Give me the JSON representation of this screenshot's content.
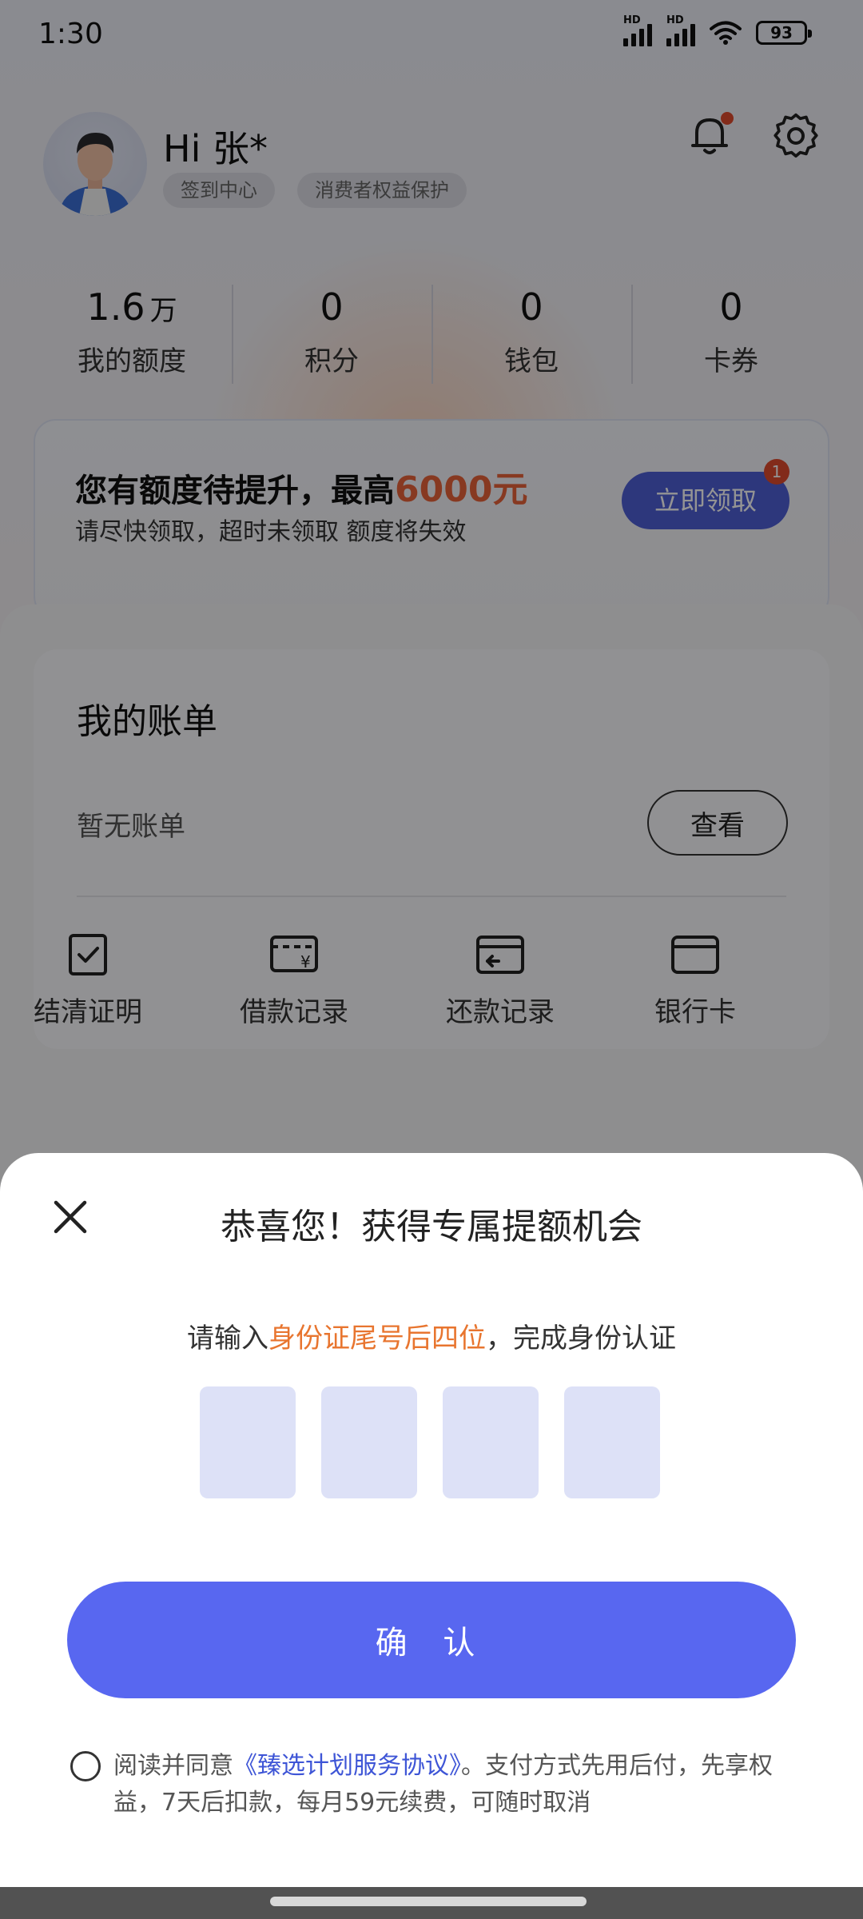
{
  "status_bar": {
    "time": "1:30",
    "signal1_label": "HD",
    "signal2_label": "HD",
    "battery": "93"
  },
  "profile": {
    "greeting": "Hi 张*",
    "checkin_label": "签到中心",
    "consumer_label": "消费者权益保护"
  },
  "stats": [
    {
      "value": "1.6",
      "unit": "万",
      "label": "我的额度"
    },
    {
      "value": "0",
      "unit": "",
      "label": "积分"
    },
    {
      "value": "0",
      "unit": "",
      "label": "钱包"
    },
    {
      "value": "0",
      "unit": "",
      "label": "卡券"
    }
  ],
  "promo": {
    "title_prefix": "您有额度待提升，最高",
    "amount": "6000元",
    "subtitle": "请尽快领取，超时未领取 额度将失效",
    "button": "立即领取",
    "badge": "1"
  },
  "bill": {
    "title": "我的账单",
    "empty": "暂无账单",
    "view_button": "查看"
  },
  "shortcuts": [
    {
      "label": "结清证明",
      "icon": "certificate-check-icon"
    },
    {
      "label": "借款记录",
      "icon": "loan-record-icon"
    },
    {
      "label": "还款记录",
      "icon": "repayment-record-icon"
    },
    {
      "label": "银行卡",
      "icon": "bank-card-icon"
    }
  ],
  "sheet": {
    "title": "恭喜您！获得专属提额机会",
    "sub_prefix": "请输入",
    "sub_highlight": "身份证尾号后四位",
    "sub_suffix": "，完成身份认证",
    "confirm": "确 认",
    "agree_prefix": "阅读并同意",
    "agree_link": "《臻选计划服务协议》",
    "agree_suffix": "。支付方式先用后付，先享权益，7天后扣款，每月59元续费，可随时取消"
  },
  "colors": {
    "accent": "#5867f0",
    "highlight": "#e8752f",
    "link": "#3e55d6",
    "promo_button": "#4f5fd6"
  }
}
